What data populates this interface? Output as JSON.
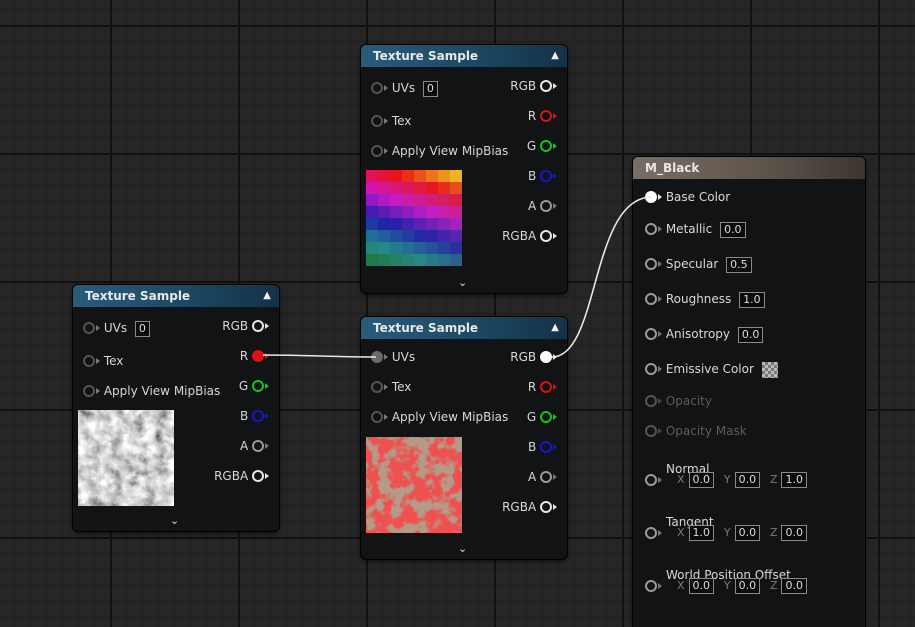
{
  "nodes": {
    "tex_top": {
      "title": "Texture Sample",
      "collapse_icon": "chevron-up-icon",
      "inputs": {
        "uvs": "UVs",
        "uvs_value": "0",
        "tex": "Tex",
        "mip": "Apply View MipBias"
      },
      "outputs": {
        "rgb": "RGB",
        "r": "R",
        "g": "G",
        "b": "B",
        "a": "A",
        "rgba": "RGBA"
      },
      "expand_icon": "chevron-down-icon"
    },
    "tex_left": {
      "title": "Texture Sample",
      "inputs": {
        "uvs": "UVs",
        "uvs_value": "0",
        "tex": "Tex",
        "mip": "Apply View MipBias"
      },
      "outputs": {
        "rgb": "RGB",
        "r": "R",
        "g": "G",
        "b": "B",
        "a": "A",
        "rgba": "RGBA"
      }
    },
    "tex_mid": {
      "title": "Texture Sample",
      "inputs": {
        "uvs": "UVs",
        "tex": "Tex",
        "mip": "Apply View MipBias"
      },
      "outputs": {
        "rgb": "RGB",
        "r": "R",
        "g": "G",
        "b": "B",
        "a": "A",
        "rgba": "RGBA"
      }
    },
    "material": {
      "title": "M_Black",
      "base_color": "Base Color",
      "metallic": "Metallic",
      "metallic_value": "0.0",
      "specular": "Specular",
      "specular_value": "0.5",
      "roughness": "Roughness",
      "roughness_value": "1.0",
      "anisotropy": "Anisotropy",
      "anisotropy_value": "0.0",
      "emissive": "Emissive Color",
      "opacity": "Opacity",
      "opacity_mask": "Opacity Mask",
      "normal": "Normal",
      "normal_xyz": {
        "x": "0.0",
        "y": "0.0",
        "z": "1.0"
      },
      "tangent": "Tangent",
      "tangent_xyz": {
        "x": "1.0",
        "y": "0.0",
        "z": "0.0"
      },
      "wpo": "World Position Offset",
      "wpo_xyz": {
        "x": "0.0",
        "y": "0.0",
        "z": "0.0"
      },
      "axis_labels": {
        "x": "X",
        "y": "Y",
        "z": "Z"
      }
    }
  },
  "colors": {
    "header_texture": "#1d4863",
    "header_material": "#5b524a",
    "pin_r": "#d21414",
    "pin_g": "#15c515",
    "pin_b": "#1616d6",
    "wire": "#e8e8e8"
  },
  "connections": [
    {
      "from": "tex_left.R",
      "to": "tex_mid.UVs"
    },
    {
      "from": "tex_mid.RGB",
      "to": "material.Base Color"
    }
  ]
}
